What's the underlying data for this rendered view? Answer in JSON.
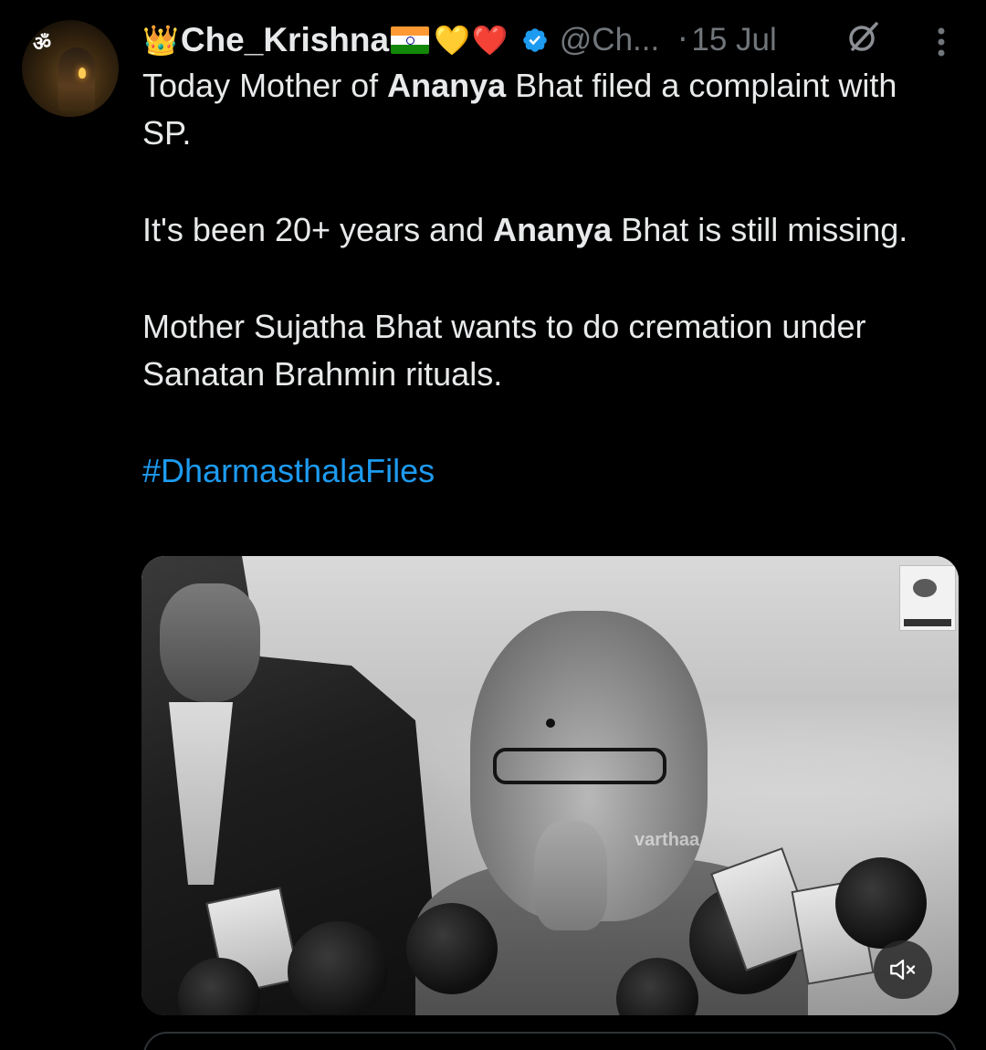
{
  "tweet": {
    "author": {
      "name_prefix_emoji": "👑",
      "name": "Che_Krishna",
      "name_suffix_emojis": [
        "🇮🇳",
        "💛",
        "❤️"
      ],
      "handle": "@Ch...",
      "verified": true,
      "avatar_icon": "om-avatar-icon"
    },
    "separator": "·",
    "date": "15 Jul",
    "body": {
      "para1_part1": "Today Mother of ",
      "para1_bold": "Ananya",
      "para1_part2": " Bhat filed a complaint with SP.",
      "para2_part1": "It's been 20+ years and ",
      "para2_bold": "Ananya",
      "para2_part2": " Bhat is still missing.",
      "para3": "Mother Sujatha Bhat wants to do cremation under Sanatan Brahmin rituals.",
      "hashtag": "#DharmasthalaFiles"
    },
    "media": {
      "type": "video",
      "watermark": "varthaa",
      "muted": true
    }
  },
  "colors": {
    "background": "#000000",
    "text": "#e7e9ea",
    "secondary_text": "#71767b",
    "link": "#1d9bf0",
    "verified": "#1d9bf0",
    "border": "#2f3336"
  },
  "icons": {
    "verified": "verified-badge-icon",
    "grok": "grok-icon",
    "more": "more-options-icon",
    "mute": "volume-muted-icon"
  }
}
